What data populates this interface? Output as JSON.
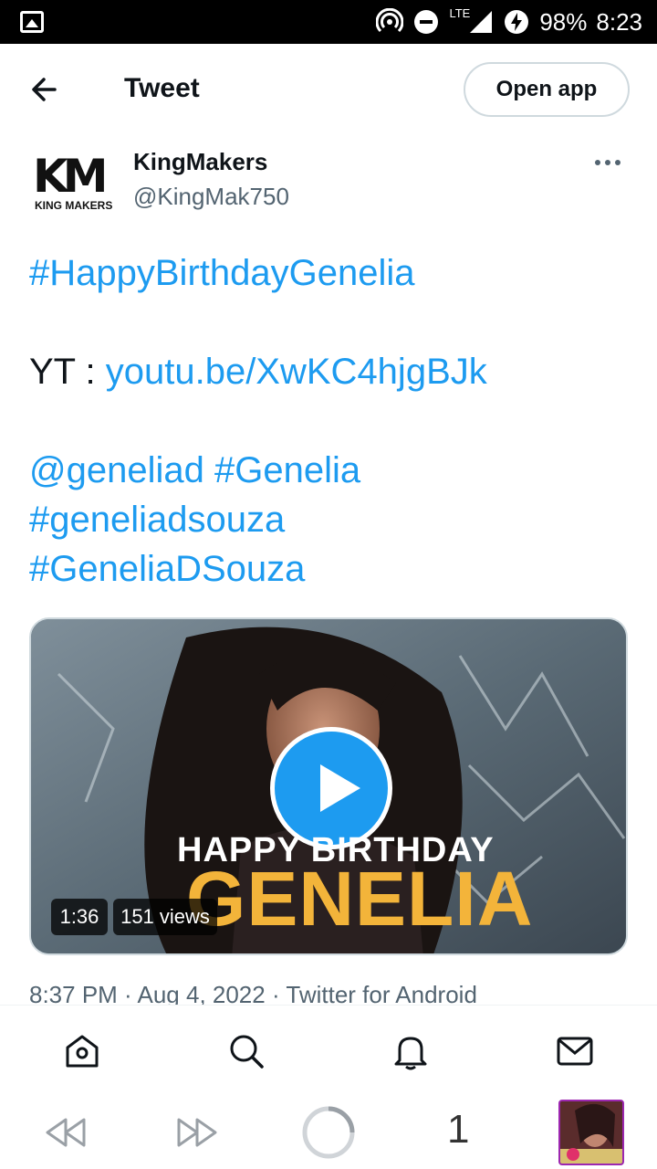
{
  "status_bar": {
    "battery": "98%",
    "time": "8:23",
    "network": "LTE"
  },
  "header": {
    "title": "Tweet",
    "open_app": "Open app"
  },
  "author": {
    "avatar_logo": "KM",
    "avatar_caption": "KING MAKERS",
    "name": "KingMakers",
    "handle": "@KingMak750"
  },
  "tweet": {
    "hashtag1": "#HappyBirthdayGenelia",
    "yt_label": "YT : ",
    "yt_link": "youtu.be/XwKC4hjgBJk",
    "mention": "@geneliad",
    "hashtag2": "#Genelia",
    "hashtag3": "#geneliadsouza",
    "hashtag4": "#GeneliaDSouza"
  },
  "media": {
    "overlay_line1": "HAPPY BIRTHDAY",
    "overlay_line2": "GENELIA",
    "duration": "1:36",
    "views": "151 views"
  },
  "meta": "8:37 PM · Aug 4, 2022 · Twitter for Android",
  "browser": {
    "tab_count": "1"
  },
  "colors": {
    "link": "#1d9bf0",
    "text": "#0f1419",
    "secondary": "#536471"
  }
}
